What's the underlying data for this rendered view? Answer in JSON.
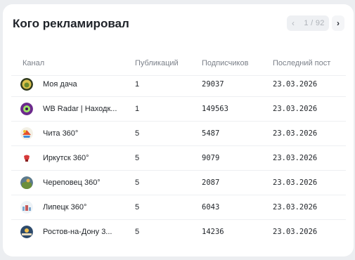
{
  "title": "Кого рекламировал",
  "pagination": {
    "prev_label": "‹",
    "counter": "1 / 92",
    "next_label": "›"
  },
  "columns": [
    "Канал",
    "Публикаций",
    "Подписчиков",
    "Последний пост"
  ],
  "rows": [
    {
      "channel": "Моя дача",
      "posts": "1",
      "subscribers": "29037",
      "last_post": "23.03.2026",
      "avatar_icon": "dacha-avatar-icon"
    },
    {
      "channel": "WB Radar | Находк...",
      "posts": "1",
      "subscribers": "149563",
      "last_post": "23.03.2026",
      "avatar_icon": "wb-radar-avatar-icon"
    },
    {
      "channel": "Чита 360°",
      "posts": "5",
      "subscribers": "5487",
      "last_post": "23.03.2026",
      "avatar_icon": "chita-avatar-icon"
    },
    {
      "channel": "Иркутск 360°",
      "posts": "5",
      "subscribers": "9079",
      "last_post": "23.03.2026",
      "avatar_icon": "irkutsk-avatar-icon"
    },
    {
      "channel": "Череповец 360°",
      "posts": "5",
      "subscribers": "2087",
      "last_post": "23.03.2026",
      "avatar_icon": "cherepovets-avatar-icon"
    },
    {
      "channel": "Липецк 360°",
      "posts": "5",
      "subscribers": "6043",
      "last_post": "23.03.2026",
      "avatar_icon": "lipetsk-avatar-icon"
    },
    {
      "channel": "Ростов-на-Дону 3...",
      "posts": "5",
      "subscribers": "14236",
      "last_post": "23.03.2026",
      "avatar_icon": "rostov-avatar-icon"
    }
  ]
}
